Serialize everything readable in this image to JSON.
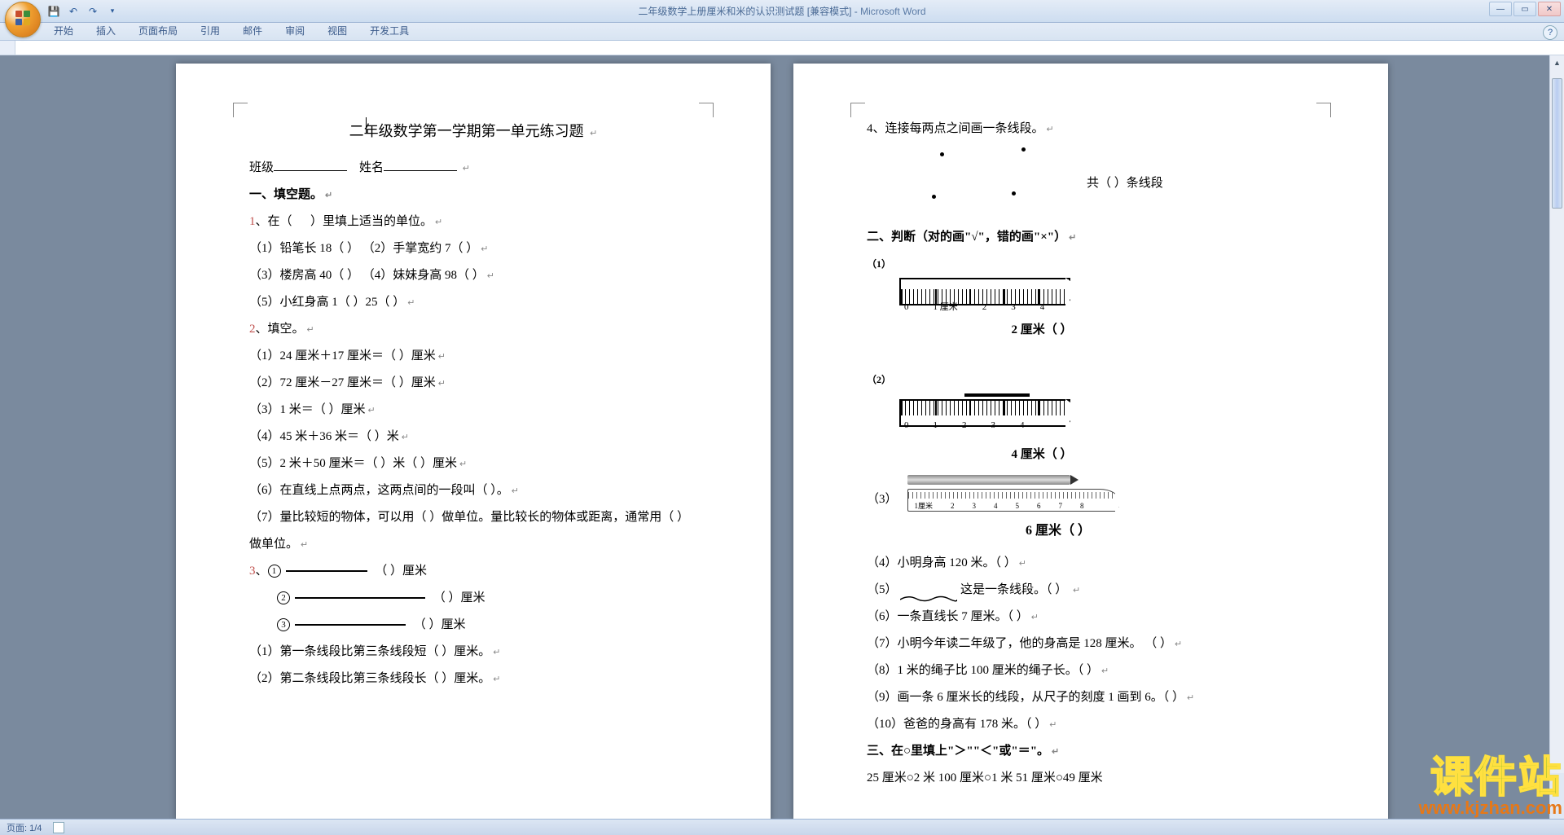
{
  "app": {
    "doc_title": "二年级数学上册厘米和米的认识测试题 [兼容模式]",
    "app_name": "Microsoft Word"
  },
  "ribbon": {
    "tabs": [
      "开始",
      "插入",
      "页面布局",
      "引用",
      "邮件",
      "审阅",
      "视图",
      "开发工具"
    ]
  },
  "status": {
    "page": "页面: 1/4"
  },
  "watermark": {
    "cn": "课件站",
    "en": "www.kjzhan.com"
  },
  "page1": {
    "title": "二年级数学第一学期第一单元练习题",
    "class_label": "班级",
    "name_label": "姓名",
    "sec1": "一、填空题。",
    "q1": "1、在（        ）里填上适当的单位。",
    "q1_1": "（1）铅笔长 18（        ）  （2）手掌宽约 7（        ）",
    "q1_3": "（3）楼房高 40（        ）  （4）妹妹身高 98（        ）",
    "q1_5": "（5）小红身高 1（    ）25（    ）",
    "q2": "2、填空。",
    "q2_1": "（1）24 厘米＋17 厘米＝（        ）厘米",
    "q2_2": "（2）72 厘米－27 厘米＝（        ）厘米",
    "q2_3": "（3）1 米＝（        ）厘米",
    "q2_4": "（4）45 米＋36 米＝（        ）米",
    "q2_5": "（5）2 米＋50 厘米＝（        ）米（        ）厘米",
    "q2_6": "（6）在直线上点两点，这两点间的一段叫（        ）。",
    "q2_7": "（7）量比较短的物体，可以用（        ）做单位。量比较长的物体或距离，通常用（        ）做单位。",
    "q3": "3、",
    "q3_unit": "（    ）厘米",
    "q3_r1": "（1）第一条线段比第三条线段短（        ）厘米。",
    "q3_r2": "（2）第二条线段比第三条线段长（        ）厘米。"
  },
  "page2": {
    "q4": "4、连接每两点之间画一条线段。",
    "q4_ans": "共（    ）条线段",
    "sec2": "二、判断（对的画\"√\"，错的画\"×\"）",
    "lbl1": "（1）",
    "lbl2": "（2）",
    "lbl3": "（3）",
    "r1_cap": "2 厘米（        ）",
    "r2_cap": "4 厘米（        ）",
    "r3_cap": "6 厘米（    ）",
    "rn_01234": "0 1 厘米 2 3 4",
    "j4": "（4）小明身高 120 米。（        ）",
    "j5_a": "（5）",
    "j5_b": "这是一条线段。（        ）",
    "j6": "（6）一条直线长 7 厘米。（        ）",
    "j7": "（7）小明今年读二年级了，他的身高是 128 厘米。 （    ）",
    "j8": "（8）1 米的绳子比 100 厘米的绳子长。（    ）",
    "j9": "（9）画一条 6 厘米长的线段，从尺子的刻度 1 画到 6。（    ）",
    "j10": "（10）爸爸的身高有 178 米。（        ）",
    "sec3": "三、在○里填上\"＞\"\"＜\"或\"＝\"。",
    "sec3_line": "25 厘米○2 米    100 厘米○1 米    51 厘米○49 厘米"
  }
}
